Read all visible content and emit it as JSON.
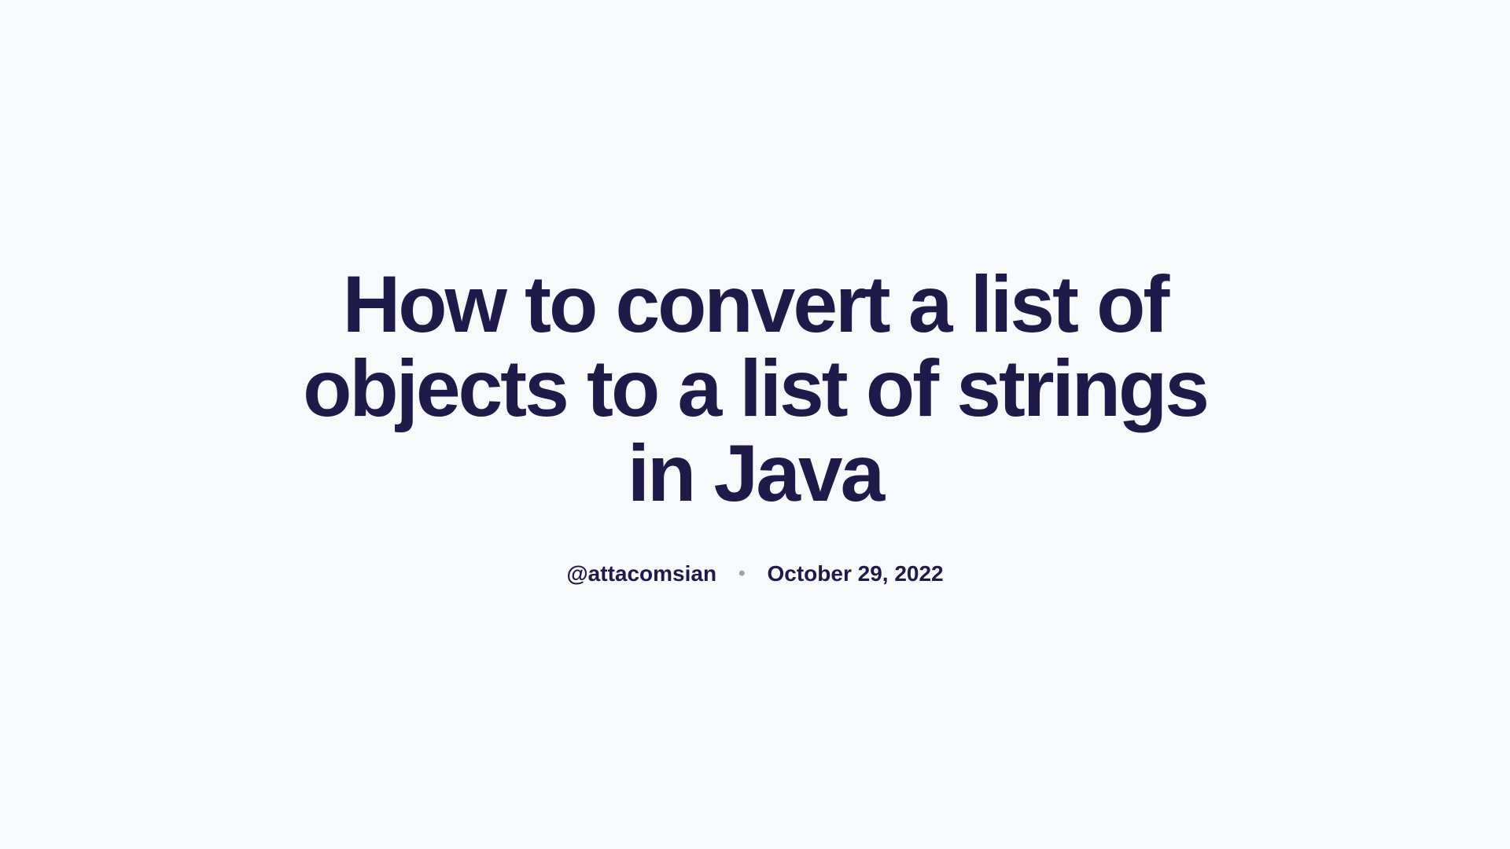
{
  "article": {
    "title": "How to convert a list of objects to a list of strings in Java",
    "author": "@attacomsian",
    "date": "October 29, 2022"
  }
}
